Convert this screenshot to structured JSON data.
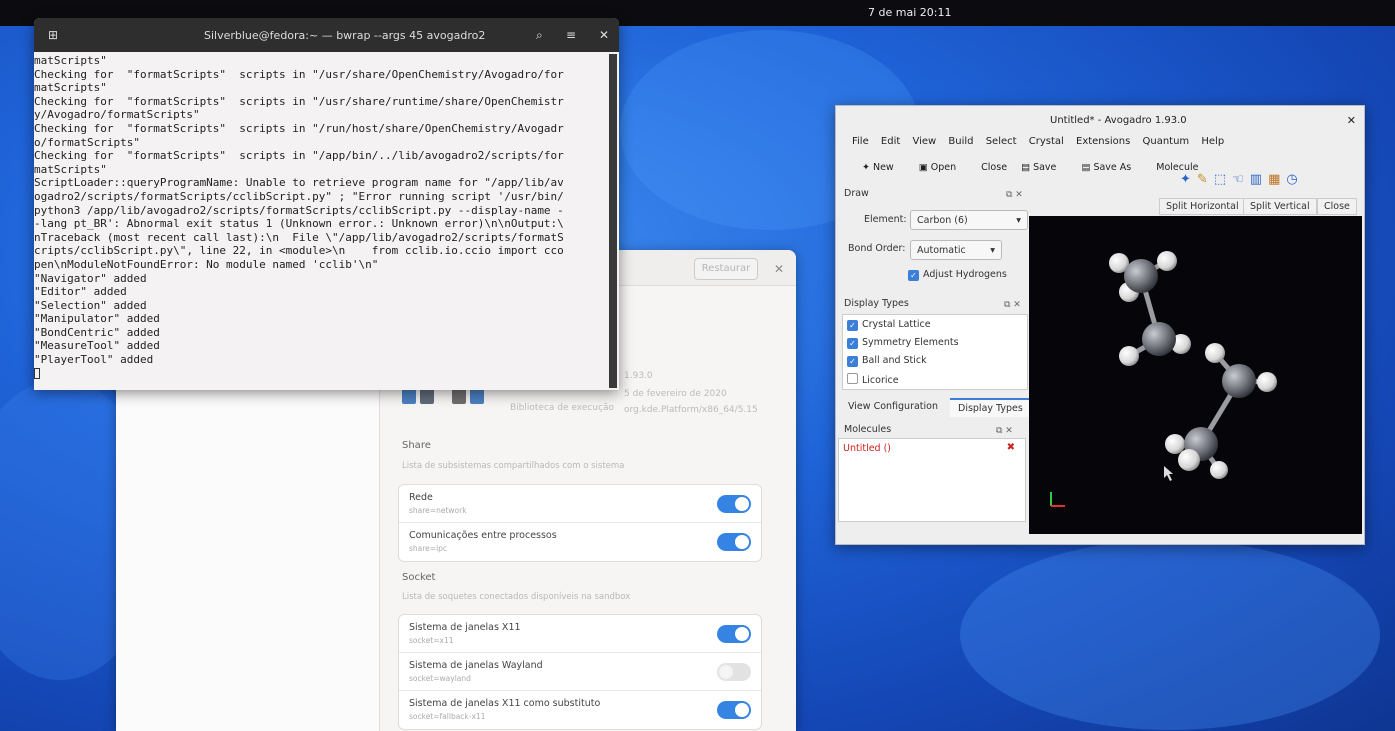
{
  "topbar": {
    "clock": "7 de mai  20:11"
  },
  "terminal": {
    "title": "Silverblue@fedora:~ — bwrap --args 45 avogadro2",
    "lines": [
      "matScripts\"",
      "Checking for  \"formatScripts\"  scripts in \"/usr/share/OpenChemistry/Avogadro/for",
      "matScripts\"",
      "Checking for  \"formatScripts\"  scripts in \"/usr/share/runtime/share/OpenChemistr",
      "y/Avogadro/formatScripts\"",
      "Checking for  \"formatScripts\"  scripts in \"/run/host/share/OpenChemistry/Avogadr",
      "o/formatScripts\"",
      "Checking for  \"formatScripts\"  scripts in \"/app/bin/../lib/avogadro2/scripts/for",
      "matScripts\"",
      "ScriptLoader::queryProgramName: Unable to retrieve program name for \"/app/lib/av",
      "ogadro2/scripts/formatScripts/cclibScript.py\" ; \"Error running script '/usr/bin/",
      "python3 /app/lib/avogadro2/scripts/formatScripts/cclibScript.py --display-name -",
      "-lang pt_BR': Abnormal exit status 1 (Unknown error.: Unknown error)\\n\\nOutput:\\",
      "nTraceback (most recent call last):\\n  File \\\"/app/lib/avogadro2/scripts/formatS",
      "cripts/cclibScript.py\\\", line 22, in <module>\\n    from cclib.io.ccio import cco",
      "pen\\nModuleNotFoundError: No module named 'cclib'\\n\"",
      "\"Navigator\" added",
      "\"Editor\" added",
      "\"Selection\" added",
      "\"Manipulator\" added",
      "\"BondCentric\" added",
      "\"MeasureTool\" added",
      "\"PlayerTool\" added"
    ]
  },
  "settings": {
    "restore_label": "Restaurar",
    "meta": {
      "version": "1.93.0",
      "date": "5 de fevereiro de 2020",
      "runtime_label": "Biblioteca de execução",
      "runtime": "org.kde.Platform/x86_64/5.15"
    },
    "share": {
      "title": "Share",
      "subtitle": "Lista de subsistemas compartilhados com o sistema",
      "rows": [
        {
          "label": "Rede",
          "key": "share=network",
          "on": true
        },
        {
          "label": "Comunicações entre processos",
          "key": "share=ipc",
          "on": true
        }
      ]
    },
    "socket": {
      "title": "Socket",
      "subtitle": "Lista de soquetes conectados disponíveis na sandbox",
      "rows": [
        {
          "label": "Sistema de janelas X11",
          "key": "socket=x11",
          "on": true
        },
        {
          "label": "Sistema de janelas Wayland",
          "key": "socket=wayland",
          "on": false
        },
        {
          "label": "Sistema de janelas X11 como substituto",
          "key": "socket=fallback-x11",
          "on": true
        }
      ]
    }
  },
  "avogadro": {
    "title": "Untitled* - Avogadro 1.93.0",
    "menu": [
      "File",
      "Edit",
      "View",
      "Build",
      "Select",
      "Crystal",
      "Extensions",
      "Quantum",
      "Help"
    ],
    "toolbar": {
      "new": "New",
      "open": "Open",
      "close": "Close",
      "save": "Save",
      "save_as": "Save As",
      "molecule": "Molecule"
    },
    "draw": {
      "title": "Draw",
      "element_label": "Element:",
      "element_value": "Carbon (6)",
      "bond_label": "Bond Order:",
      "bond_value": "Automatic",
      "adjust_h": "Adjust Hydrogens"
    },
    "display_types": {
      "title": "Display Types",
      "items": [
        {
          "label": "Crystal Lattice",
          "checked": true
        },
        {
          "label": "Symmetry Elements",
          "checked": true
        },
        {
          "label": "Ball and Stick",
          "checked": true
        },
        {
          "label": "Licorice",
          "checked": false
        }
      ]
    },
    "tabs": {
      "view_config": "View Configuration",
      "display_types": "Display Types"
    },
    "molecules": {
      "title": "Molecules",
      "item": "Untitled ()"
    },
    "viewport_tabs": {
      "split_h": "Split Horizontal",
      "split_v": "Split Vertical",
      "close": "Close"
    }
  }
}
